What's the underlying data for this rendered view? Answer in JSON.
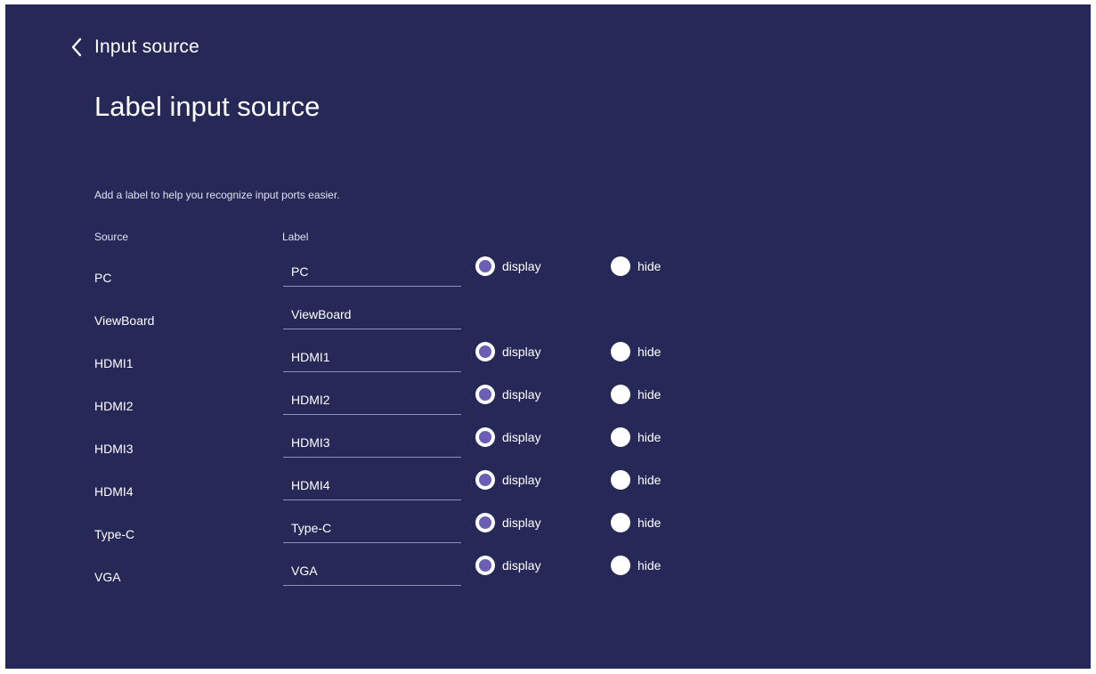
{
  "header": {
    "back_title": "Input source"
  },
  "page": {
    "title": "Label input source",
    "hint": "Add a label to help you recognize input ports easier."
  },
  "columns": {
    "source": "Source",
    "label": "Label"
  },
  "options": {
    "display": "display",
    "hide": "hide"
  },
  "rows": [
    {
      "source": "PC",
      "label": "PC",
      "has_options": true,
      "selected": "display"
    },
    {
      "source": "ViewBoard",
      "label": "ViewBoard",
      "has_options": false,
      "selected": null
    },
    {
      "source": "HDMI1",
      "label": "HDMI1",
      "has_options": true,
      "selected": "display"
    },
    {
      "source": "HDMI2",
      "label": "HDMI2",
      "has_options": true,
      "selected": "display"
    },
    {
      "source": "HDMI3",
      "label": "HDMI3",
      "has_options": true,
      "selected": "display"
    },
    {
      "source": "HDMI4",
      "label": "HDMI4",
      "has_options": true,
      "selected": "display"
    },
    {
      "source": "Type-C",
      "label": "Type-C",
      "has_options": true,
      "selected": "display"
    },
    {
      "source": "VGA",
      "label": "VGA",
      "has_options": true,
      "selected": "display"
    }
  ],
  "colors": {
    "background": "#262958",
    "radio_fill": "#ffffff",
    "radio_selected_dot": "#6b5fb5",
    "underline": "#8e91b8"
  },
  "icons": {
    "back": "chevron-left-icon"
  }
}
